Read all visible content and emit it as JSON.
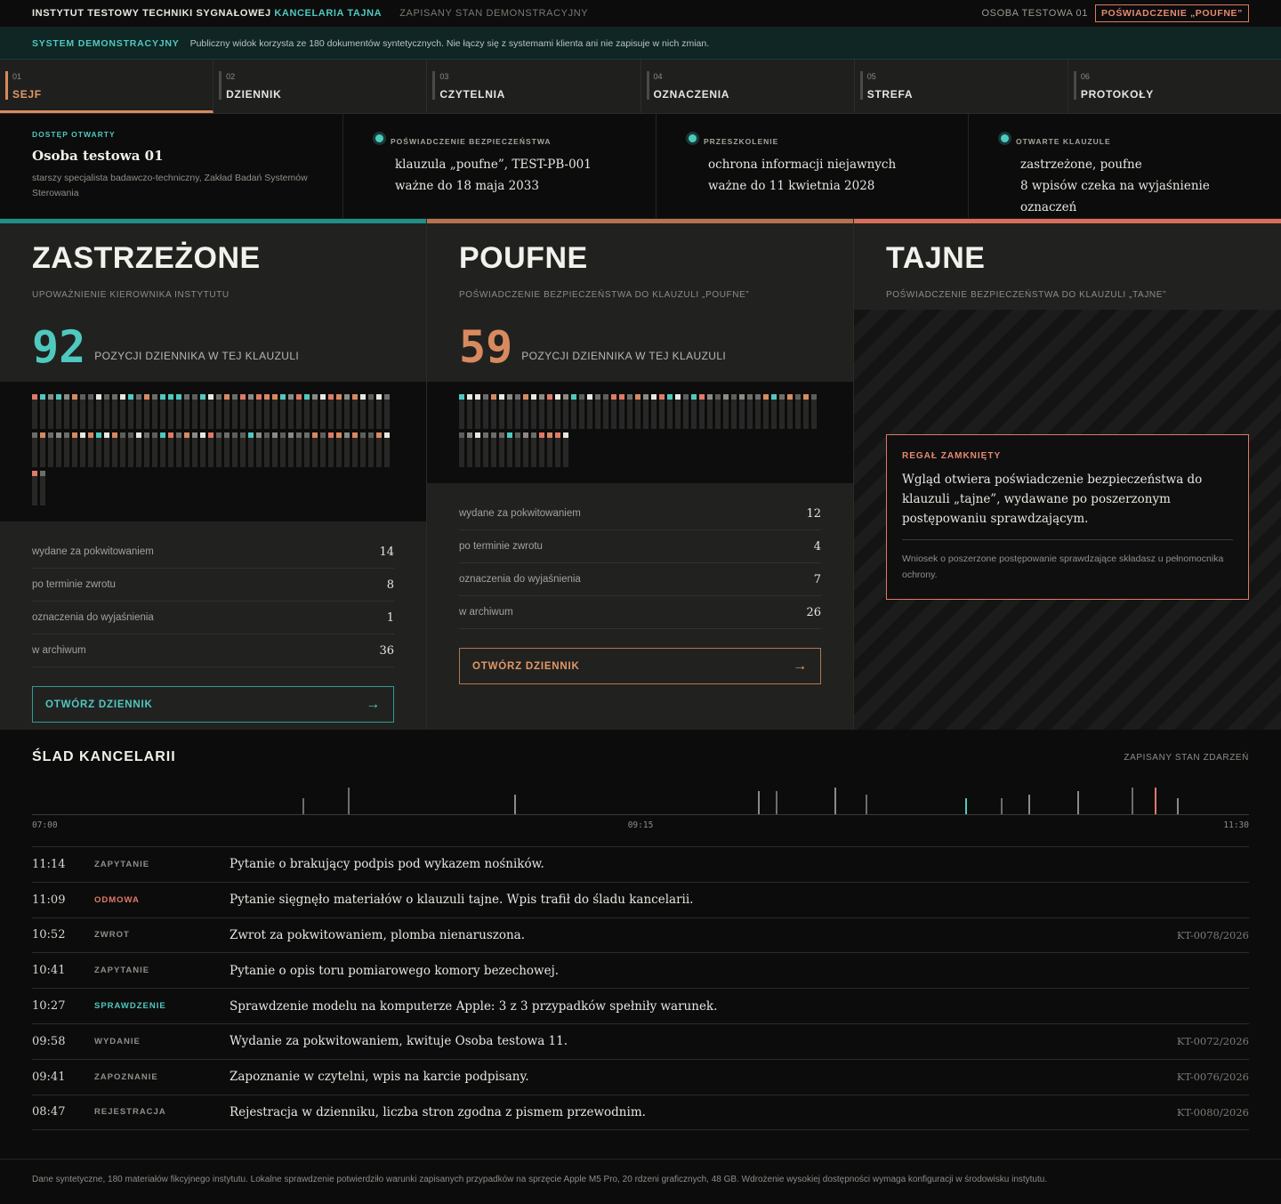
{
  "topbar": {
    "institute": "INSTYTUT TESTOWY TECHNIKI SYGNAŁOWEJ",
    "registry": "KANCELARIA TAJNA",
    "state": "ZAPISANY STAN DEMONSTRACYJNY",
    "user": "OSOBA TESTOWA 01",
    "clearance_badge": "POŚWIADCZENIE „POUFNE”"
  },
  "banner": {
    "tag": "SYSTEM DEMONSTRACYJNY",
    "text": "Publiczny widok korzysta ze 180 dokumentów syntetycznych. Nie łączy się z systemami klienta ani nie zapisuje w nich zmian."
  },
  "nav": [
    {
      "num": "01",
      "label": "SEJF"
    },
    {
      "num": "02",
      "label": "DZIENNIK"
    },
    {
      "num": "03",
      "label": "CZYTELNIA"
    },
    {
      "num": "04",
      "label": "OZNACZENIA"
    },
    {
      "num": "05",
      "label": "STREFA"
    },
    {
      "num": "06",
      "label": "PROTOKOŁY"
    }
  ],
  "status": {
    "access": "DOSTĘP OTWARTY",
    "name": "Osoba testowa 01",
    "role": "starszy specjalista badawczo-techniczny, Zakład Badań Systemów Sterowania",
    "clearance": {
      "kicker": "POŚWIADCZENIE BEZPIECZEŃSTWA",
      "line1": "klauzula „poufne”, TEST-PB-001",
      "line2": "ważne do 18 maja 2033"
    },
    "training": {
      "kicker": "PRZESZKOLENIE",
      "line1": "ochrona informacji niejawnych",
      "line2": "ważne do 11 kwietnia 2028"
    },
    "clauses": {
      "kicker": "OTWARTE KLAUZULE",
      "line1": "zastrzeżone, poufne",
      "line2": "8 wpisów czeka na wyjaśnienie oznaczeń"
    }
  },
  "columns": {
    "restricted": {
      "title": "ZASTRZEŻONE",
      "sub": "UPOWAŻNIENIE KIEROWNIKA INSTYTUTU",
      "count": "92",
      "count_label": "POZYCJI DZIENNIKA W TEJ KLAUZULI",
      "accent": "#4fc9bf",
      "stats": [
        {
          "label": "wydane za pokwitowaniem",
          "value": "14"
        },
        {
          "label": "po terminie zwrotu",
          "value": "8"
        },
        {
          "label": "oznaczenia do wyjaśnienia",
          "value": "1"
        },
        {
          "label": "w archiwum",
          "value": "36"
        }
      ],
      "button": "OTWÓRZ DZIENNIK",
      "arrow": "→"
    },
    "confidential": {
      "title": "POUFNE",
      "sub": "POŚWIADCZENIE BEZPIECZEŃSTWA DO KLAUZULI „POUFNE”",
      "count": "59",
      "count_label": "POZYCJI DZIENNIKA W TEJ KLAUZULI",
      "accent": "#d88a5e",
      "stats": [
        {
          "label": "wydane za pokwitowaniem",
          "value": "12"
        },
        {
          "label": "po terminie zwrotu",
          "value": "4"
        },
        {
          "label": "oznaczenia do wyjaśnienia",
          "value": "7"
        },
        {
          "label": "w archiwum",
          "value": "26"
        }
      ],
      "button": "OTWÓRZ DZIENNIK",
      "arrow": "→"
    },
    "secret": {
      "title": "TAJNE",
      "sub": "POŚWIADCZENIE BEZPIECZEŃSTWA DO KLAUZULI „TAJNE”",
      "accent": "#e07a66",
      "locked_kicker": "REGAŁ ZAMKNIĘTY",
      "locked_text": "Wgląd otwiera poświadczenie bezpieczeństwa do klauzuli „tajne”, wydawane po poszerzonym postępowaniu sprawdzającym.",
      "locked_note": "Wniosek o poszerzone postępowanie sprawdzające składasz u pełnomocnika ochrony."
    }
  },
  "trail": {
    "title": "ŚLAD KANCELARII",
    "state": "ZAPISANY STAN ZDARZEŃ",
    "axis_start": "07:00",
    "axis_mid": "09:15",
    "axis_end": "11:30",
    "events": [
      {
        "time": "11:14",
        "kind": "ZAPYTANIE",
        "kind_color": "#8f8f89",
        "desc": "Pytanie o brakujący podpis pod wykazem nośników.",
        "ref": ""
      },
      {
        "time": "11:09",
        "kind": "ODMOWA",
        "kind_color": "#e07a66",
        "desc": "Pytanie sięgnęło materiałów o klauzuli tajne. Wpis trafił do śladu kancelarii.",
        "ref": ""
      },
      {
        "time": "10:52",
        "kind": "ZWROT",
        "kind_color": "#8f8f89",
        "desc": "Zwrot za pokwitowaniem, plomba nienaruszona.",
        "ref": "KT-0078/2026"
      },
      {
        "time": "10:41",
        "kind": "ZAPYTANIE",
        "kind_color": "#8f8f89",
        "desc": "Pytanie o opis toru pomiarowego komory bezechowej.",
        "ref": ""
      },
      {
        "time": "10:27",
        "kind": "SPRAWDZENIE",
        "kind_color": "#4fc9bf",
        "desc": "Sprawdzenie modelu na komputerze Apple: 3 z 3 przypadków spełniły warunek.",
        "ref": ""
      },
      {
        "time": "09:58",
        "kind": "WYDANIE",
        "kind_color": "#8f8f89",
        "desc": "Wydanie za pokwitowaniem, kwituje Osoba testowa 11.",
        "ref": "KT-0072/2026"
      },
      {
        "time": "09:41",
        "kind": "ZAPOZNANIE",
        "kind_color": "#8f8f89",
        "desc": "Zapoznanie w czytelni, wpis na karcie podpisany.",
        "ref": "KT-0076/2026"
      },
      {
        "time": "08:47",
        "kind": "REJESTRACJA",
        "kind_color": "#8f8f89",
        "desc": "Rejestracja w dzienniku, liczba stron zgodna z pismem przewodnim.",
        "ref": "KT-0080/2026"
      }
    ]
  },
  "footer": "Dane syntetyczne, 180 materiałów fikcyjnego instytutu. Lokalne sprawdzenie potwierdziło warunki zapisanych przypadków na sprzęcie Apple M5 Pro, 20 rdzeni graficznych, 48 GB. Wdrożenie wysokiej dostępności wymaga konfiguracji w środowisku instytutu."
}
